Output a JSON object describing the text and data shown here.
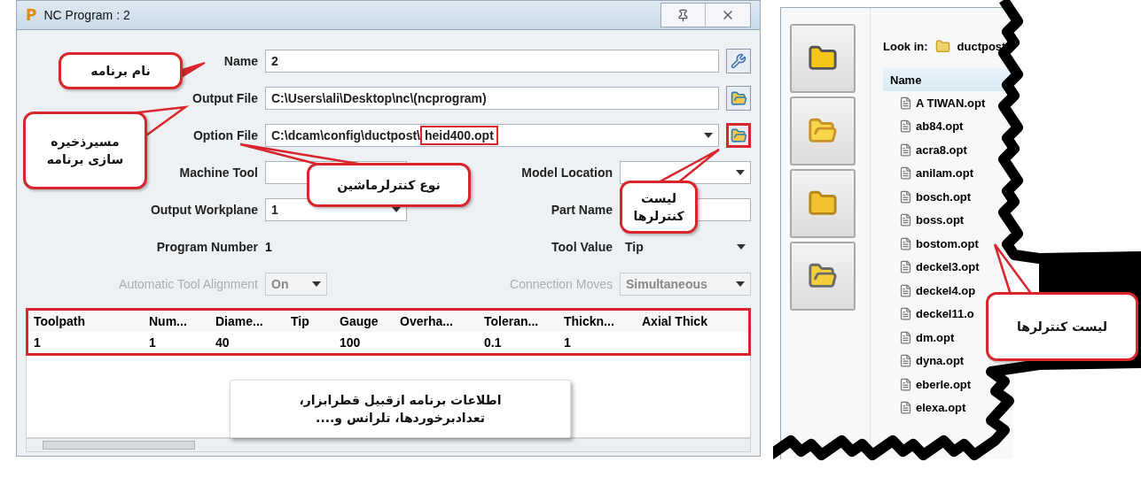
{
  "window": {
    "icon_letter": "P",
    "title": "NC Program : 2"
  },
  "form": {
    "rows": [
      {
        "fields": [
          {
            "label": "Name",
            "value": "2",
            "kind": "text",
            "disabled": false
          }
        ],
        "button": {
          "kind": "tools",
          "highlighted": false
        }
      },
      {
        "fields": [
          {
            "label": "Output File",
            "value": "C:\\Users\\ali\\Desktop\\nc\\(ncprogram)",
            "kind": "text",
            "disabled": false
          }
        ],
        "button": {
          "kind": "folder",
          "highlighted": false
        }
      },
      {
        "fields": [
          {
            "label": "Option File",
            "value": "C:\\dcam\\config\\ductpost\\",
            "highlight": "heid400.opt",
            "kind": "dropdown",
            "disabled": false
          }
        ],
        "button": {
          "kind": "folder",
          "highlighted": true
        }
      },
      {
        "fields": [
          {
            "label": "Machine Tool",
            "kind": "text",
            "disabled": false
          },
          {
            "label": "Model Location",
            "kind": "dropdown",
            "disabled": false
          }
        ]
      },
      {
        "fields": [
          {
            "label": "Output Workplane",
            "value": "1",
            "kind": "dropdown",
            "disabled": false
          },
          {
            "label": "Part Name",
            "kind": "text",
            "disabled": false
          }
        ]
      },
      {
        "fields": [
          {
            "label": "Program Number",
            "value": "1",
            "kind": "plain",
            "disabled": false
          },
          {
            "label": "Tool Value",
            "value": "Tip",
            "kind": "plain_dropdown",
            "disabled": false
          }
        ]
      },
      {
        "fields": [
          {
            "label": "Automatic Tool Alignment",
            "value": "On",
            "kind": "compact_dropdown",
            "disabled": true
          },
          {
            "label": "Connection Moves",
            "value": "Simultaneous",
            "kind": "dropdown",
            "disabled": true
          }
        ]
      }
    ]
  },
  "table": {
    "highlighted": true,
    "columns": [
      "Toolpath",
      "Num...",
      "Diame...",
      "Tip",
      "Gauge",
      "Overha...",
      "Toleran...",
      "Thickn...",
      "Axial Thick"
    ],
    "rows": [
      {
        "cells": [
          "1",
          "1",
          "40",
          null,
          "100",
          null,
          "0.1",
          "1",
          null
        ]
      }
    ]
  },
  "callouts": [
    {
      "kind": "bubble",
      "lines": [
        "نام برنامه"
      ]
    },
    {
      "kind": "bubble",
      "lines": [
        "مسیرذخیره",
        "سازی برنامه"
      ]
    },
    {
      "kind": "bubble",
      "lines": [
        "نوع کنترلرماشین"
      ]
    },
    {
      "kind": "bubble",
      "lines": [
        "لیست",
        "کنترلرها"
      ]
    },
    {
      "kind": "note",
      "lines": [
        "اطلاعات برنامه ازقبیل قطرابزار،",
        "تعدادبرخوردها، تلرانس و...."
      ]
    }
  ],
  "file_dialog": {
    "look_in_label": "Look in:",
    "folder": "ductpost",
    "column": "Name",
    "files": [
      "A TIWAN.opt",
      "ab84.opt",
      "acra8.opt",
      "anilam.opt",
      "bosch.opt",
      "boss.opt",
      "bostom.opt",
      "deckel3.opt",
      "deckel4.op",
      "deckel11.o",
      "dm.opt",
      "dyna.opt",
      "eberle.opt",
      "elexa.opt"
    ],
    "callout": {
      "kind": "bubble",
      "lines": [
        "لیست کنترلرها"
      ]
    }
  }
}
